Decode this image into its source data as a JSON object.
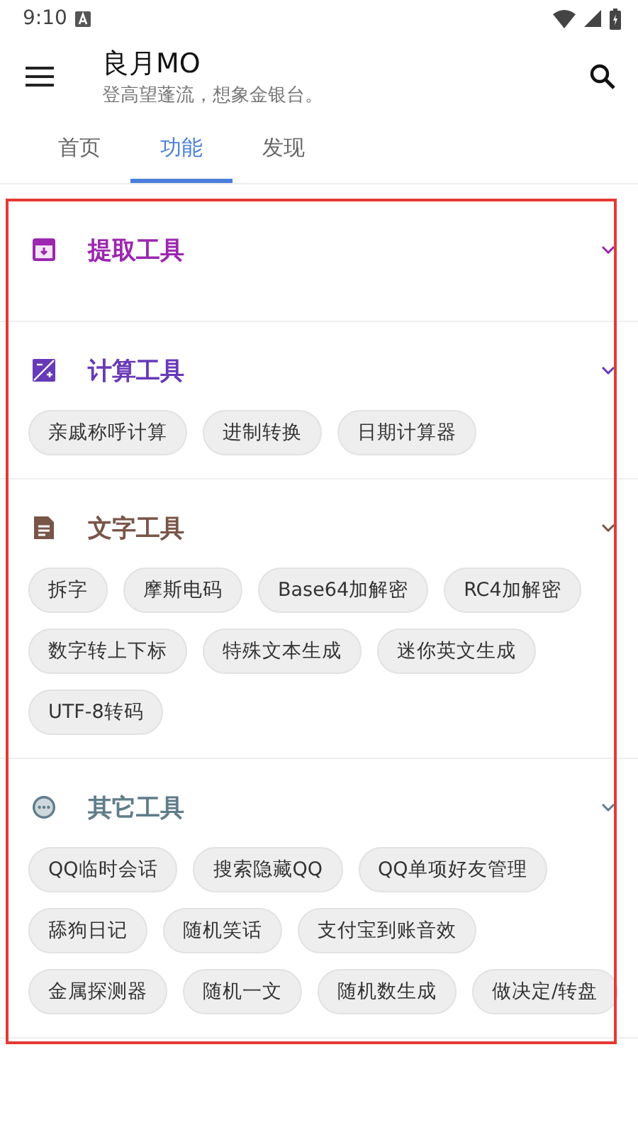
{
  "status_bar": {
    "time": "9:10"
  },
  "app_bar": {
    "title": "良月MO",
    "subtitle": "登高望蓬流，想象金银台。"
  },
  "tabs": [
    {
      "label": "首页",
      "selected": false
    },
    {
      "label": "功能",
      "selected": true
    },
    {
      "label": "发现",
      "selected": false
    }
  ],
  "sections": [
    {
      "title": "提取工具",
      "kind": "archive",
      "color": "#9c27b0"
    },
    {
      "title": "计算工具",
      "kind": "calculator",
      "color": "#673ab7",
      "tools": [
        "亲戚称呼计算",
        "进制转换",
        "日期计算器"
      ]
    },
    {
      "title": "文字工具",
      "kind": "document",
      "color": "#795548",
      "tools": [
        "拆字",
        "摩斯电码",
        "Base64加解密",
        "RC4加解密",
        "数字转上下标",
        "特殊文本生成",
        "迷你英文生成",
        "UTF-8转码"
      ]
    },
    {
      "title": "其它工具",
      "kind": "more",
      "color": "#607d8b",
      "tools": [
        "QQ临时会话",
        "搜索隐藏QQ",
        "QQ单项好友管理",
        "舔狗日记",
        "随机笑话",
        "支付宝到账音效",
        "金属探测器",
        "随机一文",
        "随机数生成",
        "做决定/转盘"
      ]
    }
  ]
}
